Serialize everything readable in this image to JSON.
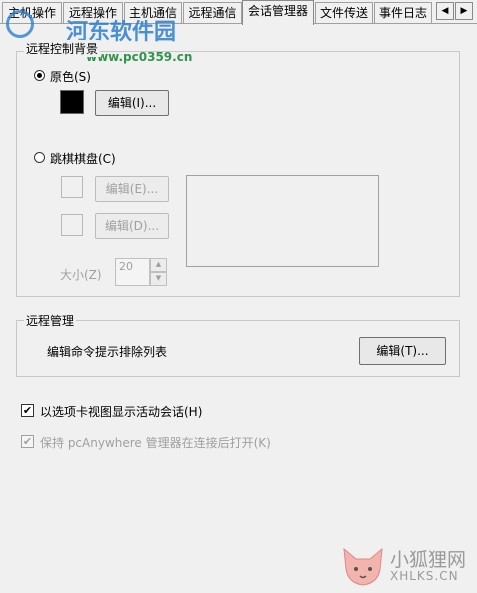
{
  "tabs": [
    {
      "label": "主机操作",
      "active": false
    },
    {
      "label": "远程操作",
      "active": false
    },
    {
      "label": "主机通信",
      "active": false
    },
    {
      "label": "远程通信",
      "active": false
    },
    {
      "label": "会话管理器",
      "active": true
    },
    {
      "label": "文件传送",
      "active": false
    },
    {
      "label": "事件日志",
      "active": false
    }
  ],
  "scroll_buttons": {
    "left": "◀",
    "right": "▶"
  },
  "remote_bg": {
    "title": "远程控制背景",
    "original_color_label": "原色(S)",
    "original_color_selected": true,
    "swatch_color": "#000000",
    "edit_i_label": "编辑(I)...",
    "checker_label": "跳棋棋盘(C)",
    "checker_selected": false,
    "edit_e_label": "编辑(E)...",
    "edit_d_label": "编辑(D)...",
    "size_label": "大小(Z)",
    "size_value": "20"
  },
  "remote_mgmt": {
    "title": "远程管理",
    "description": "编辑命令提示排除列表",
    "edit_t_label": "编辑(T)..."
  },
  "options": {
    "show_tab_view_label": "以选项卡视图显示活动会话(H)",
    "show_tab_view_checked": true,
    "keep_open_label": "保持 pcAnywhere 管理器在连接后打开(K)",
    "keep_open_checked": true
  },
  "watermark_top": {
    "title": "河东软件园",
    "url": "www.pc0359.cn"
  },
  "watermark_bottom": {
    "title": "小狐狸网",
    "url": "XHLKS.CN"
  },
  "colors": {
    "watermark_blue": "#2d7fd0",
    "watermark_green": "#1e8a3a"
  }
}
